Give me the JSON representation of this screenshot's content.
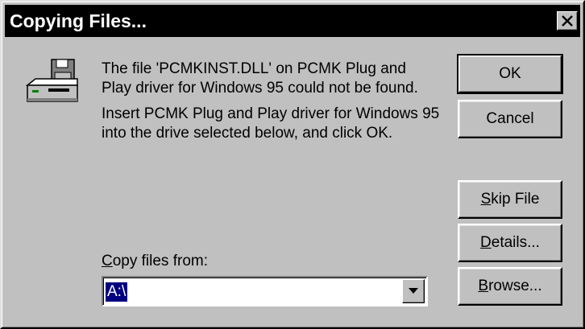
{
  "dialog": {
    "title": "Copying Files...",
    "close_glyph": "×",
    "icon": "disk-drive-icon"
  },
  "message": {
    "line1": "The file 'PCMKINST.DLL' on PCMK Plug and Play driver for Windows 95 could not be found.",
    "line2": "Insert PCMK Plug and Play driver for Windows 95 into the drive selected below, and click OK."
  },
  "copy_from": {
    "label_accel": "C",
    "label_rest": "opy files from:",
    "value": "A:\\"
  },
  "buttons": {
    "ok": "OK",
    "cancel": "Cancel",
    "skip_accel": "S",
    "skip_rest": "kip File",
    "details_accel": "D",
    "details_rest": "etails...",
    "browse_accel": "B",
    "browse_rest": "rowse..."
  }
}
